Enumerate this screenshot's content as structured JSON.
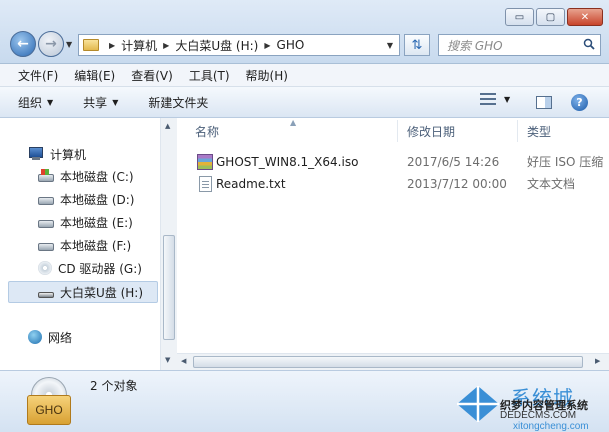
{
  "window": {
    "minimize_label": "▭",
    "maximize_label": "▢",
    "close_label": "✕"
  },
  "address": {
    "crumbs": [
      "计算机",
      "大白菜U盘 (H:)",
      "GHO"
    ]
  },
  "search": {
    "placeholder": "搜索 GHO"
  },
  "menu": {
    "items": [
      "文件(F)",
      "编辑(E)",
      "查看(V)",
      "工具(T)",
      "帮助(H)"
    ]
  },
  "toolbar": {
    "organize_label": "组织",
    "share_label": "共享",
    "new_folder_label": "新建文件夹"
  },
  "sidebar": {
    "items": [
      {
        "label": "计算机",
        "icon": "computer-icon"
      },
      {
        "label": "本地磁盘 (C:)",
        "icon": "system-drive-icon"
      },
      {
        "label": "本地磁盘 (D:)",
        "icon": "drive-icon"
      },
      {
        "label": "本地磁盘 (E:)",
        "icon": "drive-icon"
      },
      {
        "label": "本地磁盘 (F:)",
        "icon": "drive-icon"
      },
      {
        "label": "CD 驱动器 (G:)",
        "icon": "cd-drive-icon"
      },
      {
        "label": "大白菜U盘 (H:)",
        "icon": "usb-drive-icon",
        "selected": true
      },
      {
        "label": "网络",
        "icon": "network-icon"
      }
    ]
  },
  "filelist": {
    "columns": {
      "name": "名称",
      "modified": "修改日期",
      "type": "类型"
    },
    "rows": [
      {
        "name": "GHOST_WIN8.1_X64.iso",
        "modified": "2017/6/5 14:26",
        "type": "好压 ISO 压缩",
        "icon": "archive-icon"
      },
      {
        "name": "Readme.txt",
        "modified": "2013/7/12 00:00",
        "type": "文本文档",
        "icon": "text-file-icon"
      }
    ]
  },
  "details": {
    "icon_label": "GHO",
    "count_text": "2 个对象"
  },
  "watermark": {
    "title": "系统城",
    "line1": "织梦内容管理系统",
    "line2": "DEDECMS.COM",
    "line3": "xitongcheng.com"
  },
  "colors": {
    "accent": "#2a68b2",
    "selection": "#dde8f5"
  }
}
